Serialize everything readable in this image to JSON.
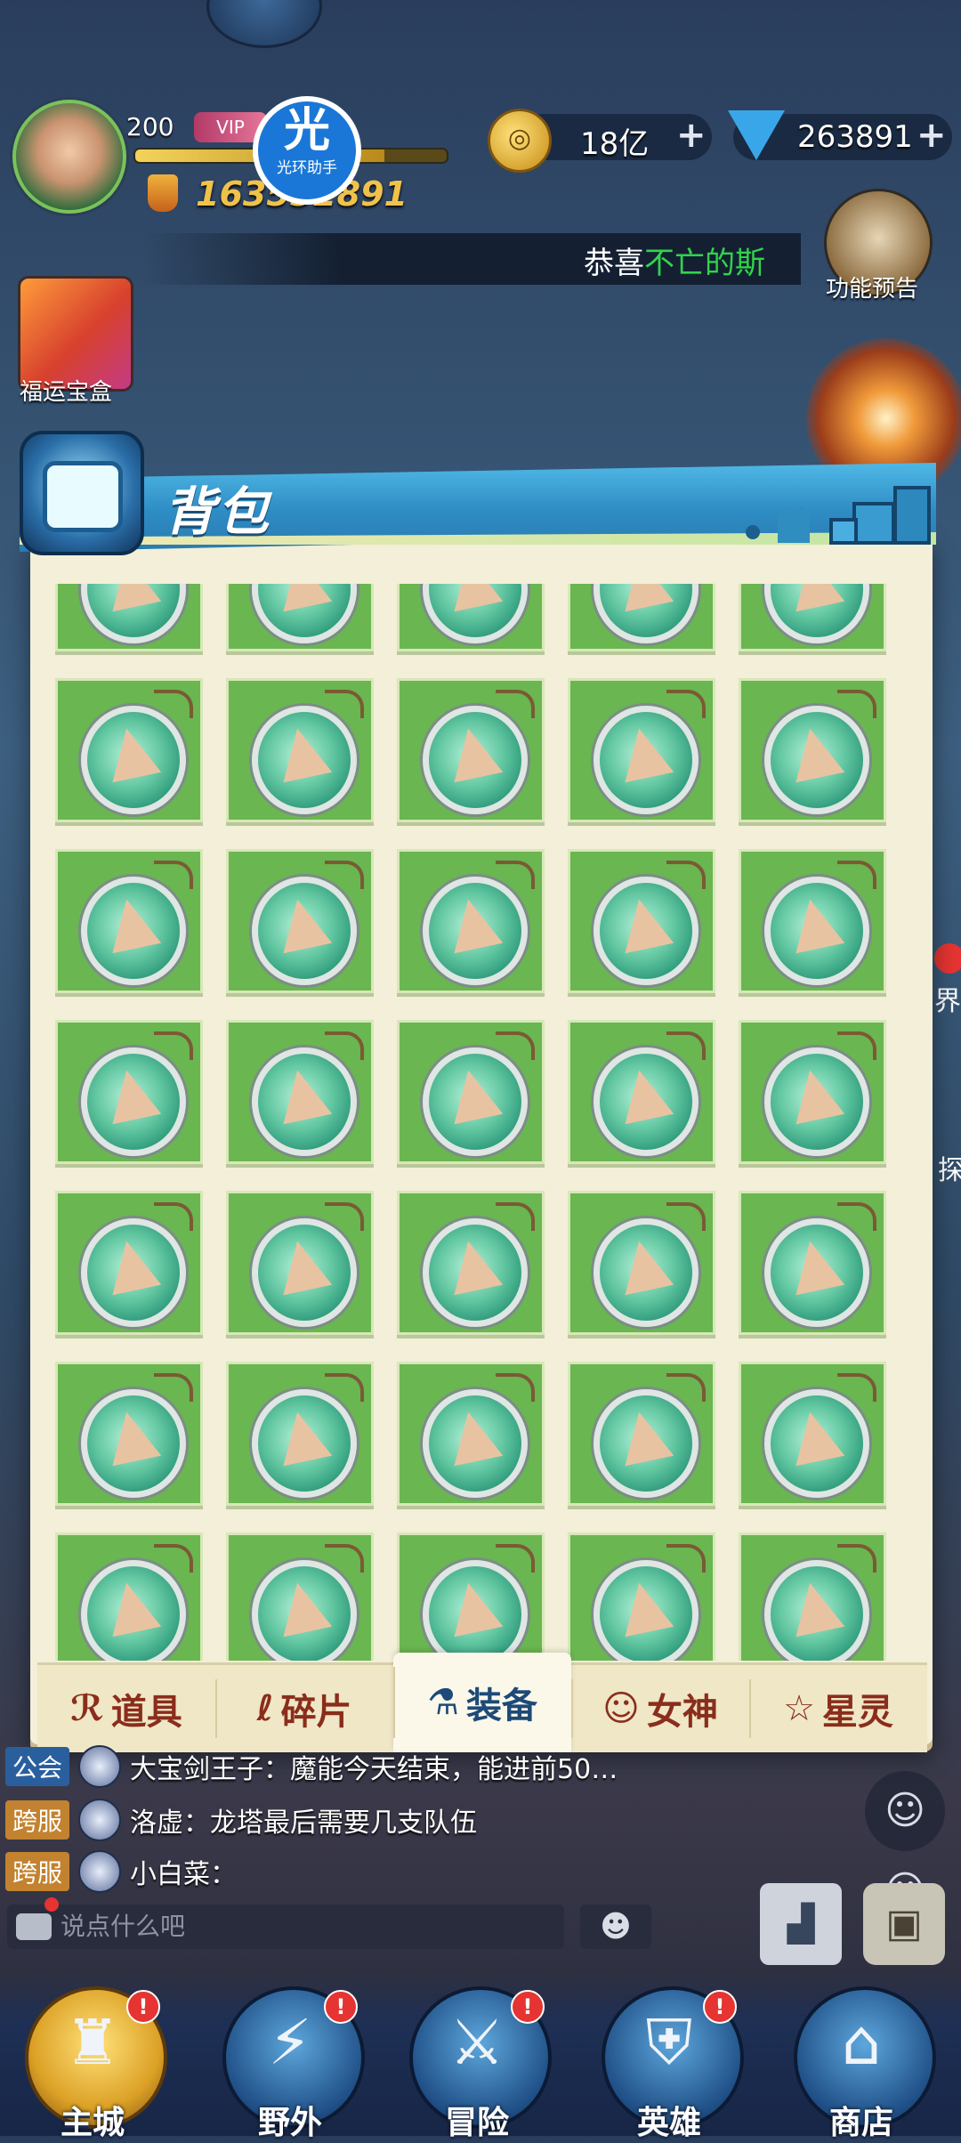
{
  "player": {
    "level": "200",
    "vip_badge": "VIP",
    "exp_fraction": 0.8,
    "power": "163552891"
  },
  "helper_badge": {
    "glyph": "光",
    "label": "光环助手"
  },
  "resources": {
    "gold": "18亿",
    "gems": "263891",
    "plus": "+"
  },
  "news": {
    "prefix": "恭喜",
    "name": "不亡的斯"
  },
  "side_buttons": {
    "feature_preview": "功能预告",
    "lucky_box": "福运宝盒",
    "hint_1": "界",
    "hint_2": "探"
  },
  "panel": {
    "title": "背包",
    "item_icon": "amulet-icon",
    "rows_visible": 8,
    "columns": 5
  },
  "tabs": [
    {
      "label": "道具",
      "icon": "props-icon",
      "glyph": "ℛ"
    },
    {
      "label": "碎片",
      "icon": "fragment-icon",
      "glyph": "ℓ"
    },
    {
      "label": "装备",
      "icon": "equipment-icon",
      "glyph": "⚗"
    },
    {
      "label": "女神",
      "icon": "goddess-icon",
      "glyph": "☺"
    },
    {
      "label": "星灵",
      "icon": "star-spirit-icon",
      "glyph": "☆"
    }
  ],
  "chat": {
    "messages": [
      {
        "channel": "公会",
        "text": "大宝剑王子：魔能今天结束，能进前50…"
      },
      {
        "channel": "跨服",
        "text": "洛虚：龙塔最后需要几支队伍"
      },
      {
        "channel": "跨服",
        "text": "小白菜："
      }
    ],
    "placeholder": "说点什么吧",
    "emoji": "☻"
  },
  "nav": [
    {
      "label": "主城",
      "glyph": "♜",
      "alert": "!"
    },
    {
      "label": "野外",
      "glyph": "⚡",
      "alert": "!"
    },
    {
      "label": "冒险",
      "glyph": "⚔",
      "alert": "!"
    },
    {
      "label": "英雄",
      "glyph": "⛨",
      "alert": "!"
    },
    {
      "label": "商店",
      "glyph": "⌂",
      "alert": ""
    }
  ],
  "colors": {
    "panel_bg": "#f3efd8",
    "cell_bg": "#6ab650",
    "header_blue": "#2e8cc4",
    "tab_text": "#8b2d1c",
    "tab_active_text": "#1d4a78",
    "alert_red": "#e53431"
  }
}
